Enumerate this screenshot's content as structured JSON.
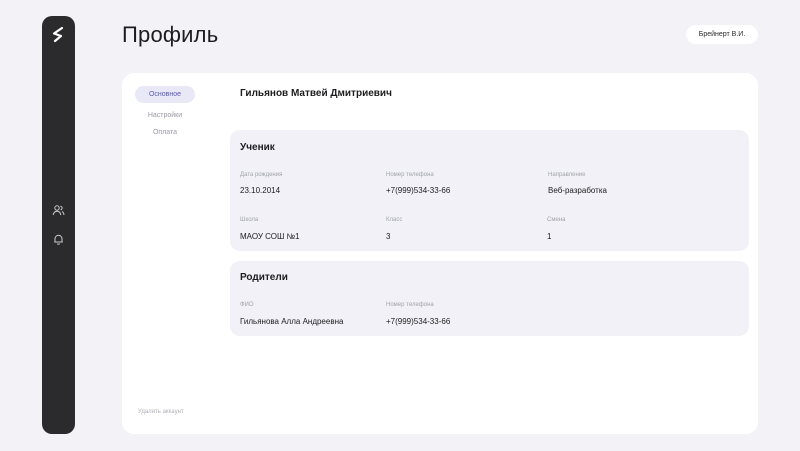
{
  "page": {
    "title": "Профиль"
  },
  "header": {
    "user_name": "Брейнерт В.И."
  },
  "sidebar": {
    "icons": [
      {
        "name": "logo-icon"
      },
      {
        "name": "users-icon"
      },
      {
        "name": "bell-icon"
      }
    ]
  },
  "tabs": [
    {
      "label": "Основное",
      "active": true
    },
    {
      "label": "Настройки",
      "active": false
    },
    {
      "label": "Оплата",
      "active": false
    }
  ],
  "delete_account_label": "Удалить аккаунт",
  "profile": {
    "full_name": "Гильянов Матвей Дмитриевич"
  },
  "student": {
    "title": "Ученик",
    "birth_date": {
      "label": "Дата рождения",
      "value": "23.10.2014"
    },
    "phone": {
      "label": "Номер телефона",
      "value": "+7(999)534-33-66"
    },
    "direction": {
      "label": "Направление",
      "value": "Веб-разработка"
    },
    "school": {
      "label": "Школа",
      "value": "МАОУ СОШ №1"
    },
    "grade": {
      "label": "Класс",
      "value": "3"
    },
    "shift": {
      "label": "Смена",
      "value": "1"
    }
  },
  "parents": {
    "title": "Родители",
    "name": {
      "label": "ФИО",
      "value": "Гильянова Алла Андреевна"
    },
    "phone": {
      "label": "Номер телефона",
      "value": "+7(999)534-33-66"
    }
  },
  "colors": {
    "rail": "#2b2b2d",
    "background": "#f2f2f7",
    "active_tab": "#e8e8f6",
    "accent": "#5b5bb8"
  }
}
